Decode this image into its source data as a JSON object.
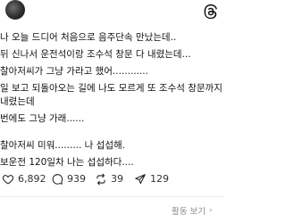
{
  "post": {
    "lines": [
      "나 오늘 드디어 처음으로 음주단속 만났는데..",
      "뒤 신나서 운전석이랑 조수석 창문 다 내렸는데...",
      "찰아저씨가 그냥 가라고 했어............",
      "일 보고 되돌아오는 길에 나도 모르게 또 조수석 창문까지",
      "내렸는데",
      "번에도 그냥 가래......",
      "찰아저씨 미워......... 나 섭섭해.",
      "보운전 120일차 나는 섭섭하다...."
    ]
  },
  "actions": {
    "likes": "6,892",
    "comments": "939",
    "reposts": "39",
    "shares": "129"
  },
  "footer": {
    "activity_label": "활동 보기",
    "chevron": "›"
  },
  "icons": {
    "brand": "threads-logo-icon",
    "like": "heart-icon",
    "comment": "comment-icon",
    "repost": "repost-icon",
    "share": "share-icon"
  }
}
